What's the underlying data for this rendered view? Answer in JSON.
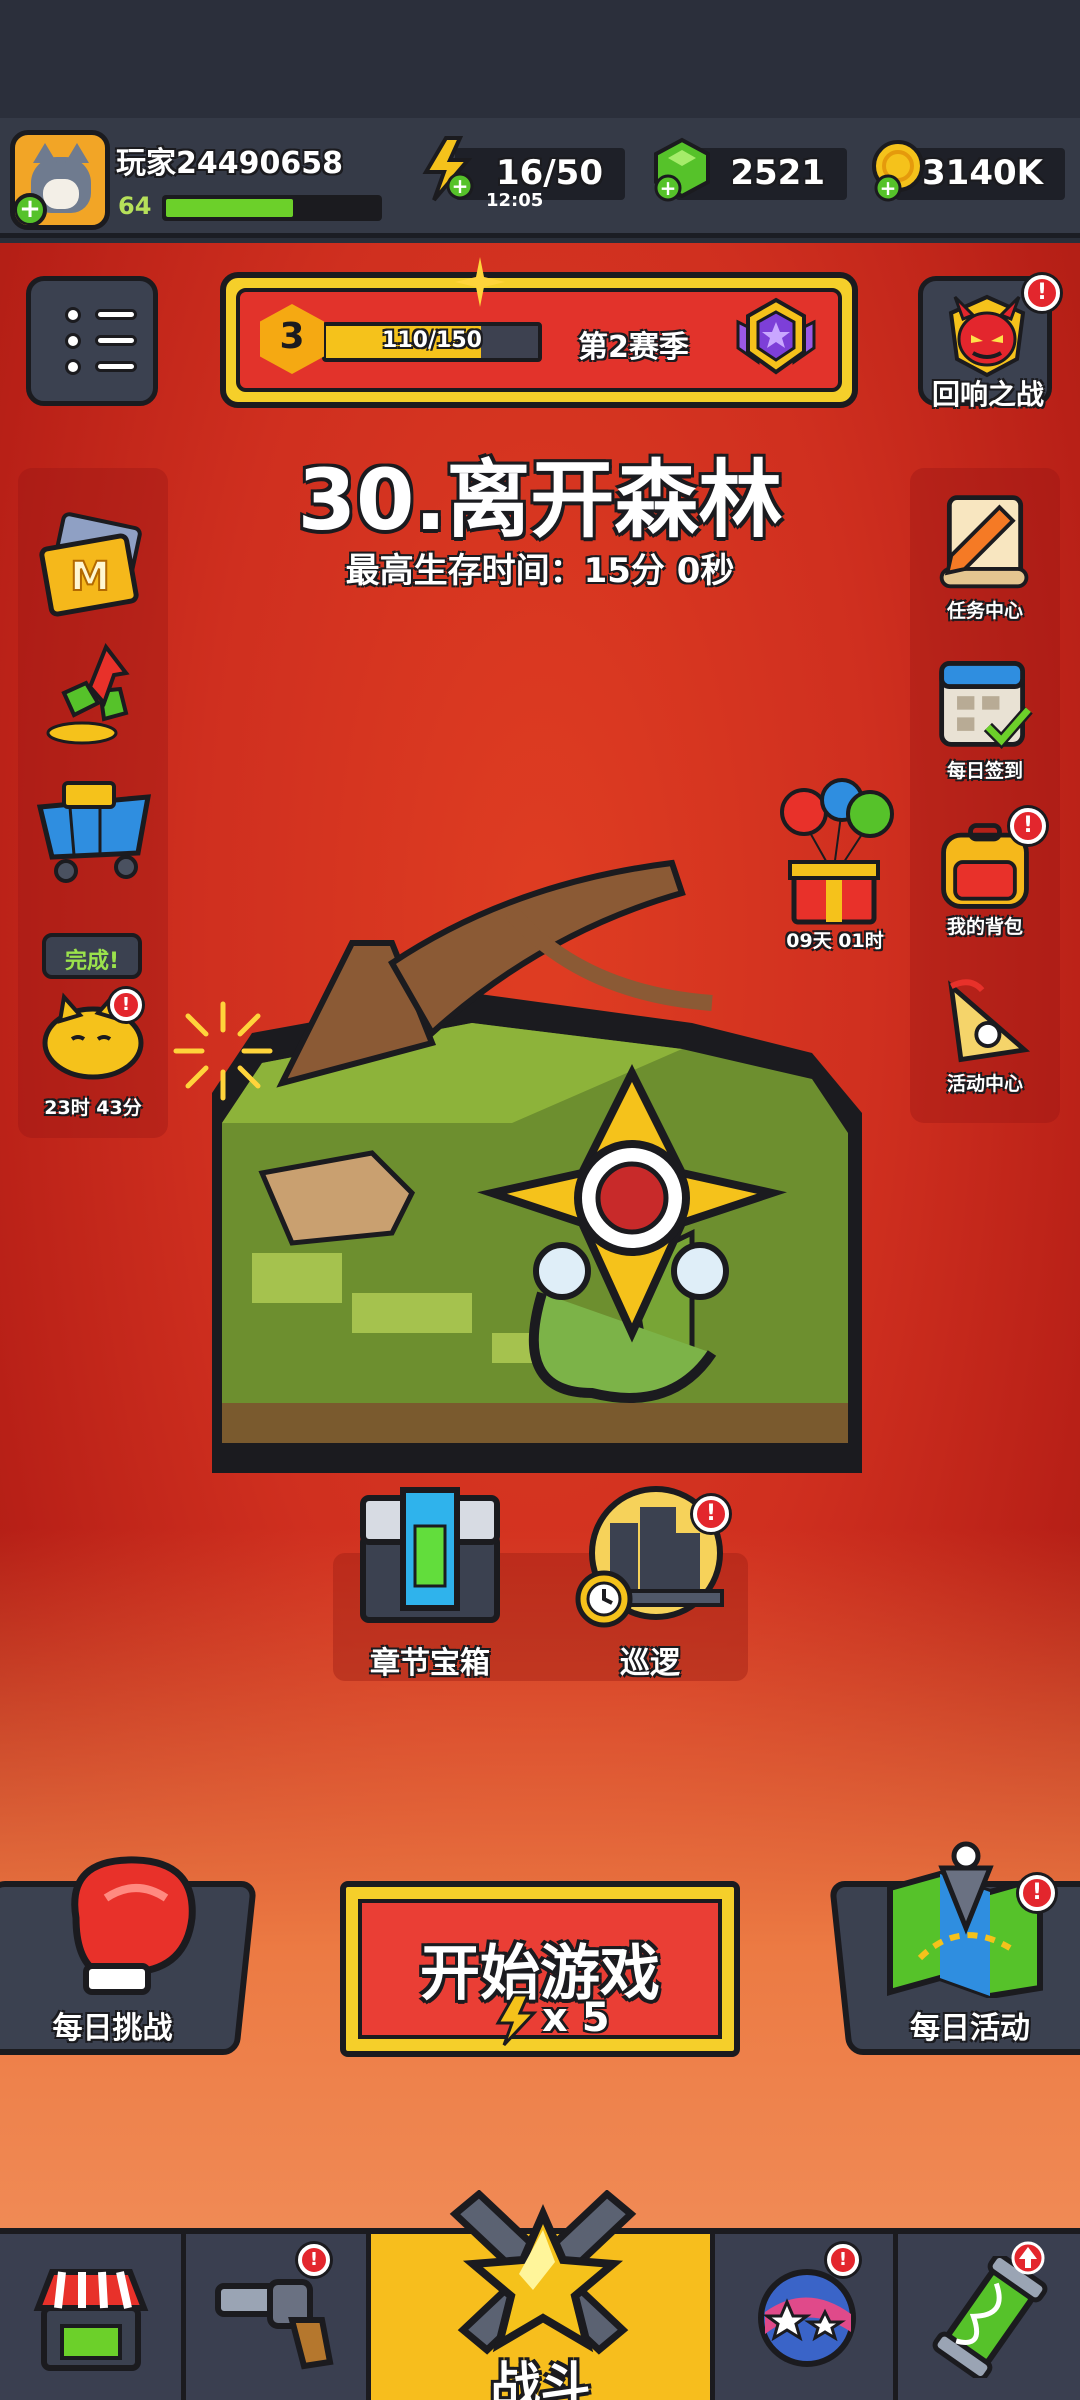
{
  "player": {
    "name": "玩家24490658",
    "level": "64",
    "xp_fraction": 0.6
  },
  "resources": {
    "energy": "16/50",
    "energy_timer": "12:05",
    "gems": "2521",
    "gold": "3140K"
  },
  "season": {
    "level": "3",
    "progress": "110/150",
    "progress_fraction": 0.733,
    "label": "第2赛季"
  },
  "chapter": {
    "title": "30.离开森林",
    "best_time": "最高生存时间：15分 0秒"
  },
  "left_sidebar": {
    "pass_icon_letter": "M",
    "cat_status": "完成!",
    "cat_timer": "23时 43分"
  },
  "right_sidebar": {
    "echo_battle": "回响之战",
    "task_center": "任务中心",
    "daily_checkin": "每日签到",
    "my_backpack": "我的背包",
    "event_center": "活动中心",
    "gift_timer": "09天 01时"
  },
  "chests": {
    "chapter_chest": "章节宝箱",
    "patrol": "巡逻"
  },
  "actions": {
    "daily_challenge": "每日挑战",
    "daily_event": "每日活动",
    "start_game": "开始游戏",
    "start_cost": "x 5"
  },
  "bottom_nav": {
    "battle": "战斗"
  },
  "alert_mark": "!",
  "colors": {
    "arena_red": "#d3331f",
    "accent_yellow": "#f5cf2a",
    "gem_green": "#56c22a",
    "panel_dark": "#3b4150"
  }
}
